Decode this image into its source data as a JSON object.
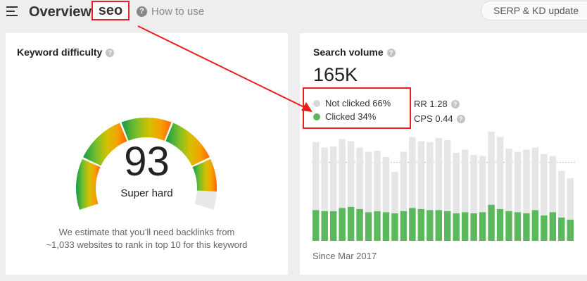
{
  "header": {
    "title": "Overview",
    "keyword": "seo",
    "help_label": "How to use",
    "serp_button_label": "SERP & KD update"
  },
  "keyword_difficulty": {
    "title": "Keyword difficulty",
    "score": "93",
    "rating": "Super hard",
    "score_fraction": 0.93,
    "description_line1": "We estimate that you’ll need backlinks from",
    "description_line2": "~1,033 websites to rank in top 10 for this keyword"
  },
  "search_volume": {
    "title": "Search volume",
    "value": "165K",
    "legend": {
      "not_clicked": "Not clicked 66%",
      "clicked": "Clicked 34%"
    },
    "rr": "RR 1.28",
    "cps": "CPS 0.44",
    "since": "Since Mar 2017"
  },
  "colors": {
    "accent_red": "#e8201e",
    "clicked_green": "#5cb85c",
    "not_clicked_gray": "#e6e6e6"
  },
  "chart_data": {
    "type": "bar",
    "stacked": true,
    "series": [
      {
        "name": "Clicked",
        "values": [
          0.29,
          0.28,
          0.28,
          0.31,
          0.32,
          0.3,
          0.27,
          0.28,
          0.27,
          0.26,
          0.28,
          0.31,
          0.3,
          0.29,
          0.29,
          0.28,
          0.26,
          0.27,
          0.26,
          0.27,
          0.34,
          0.3,
          0.28,
          0.27,
          0.26,
          0.29,
          0.24,
          0.27,
          0.22,
          0.2
        ]
      },
      {
        "name": "Not clicked",
        "values": [
          0.64,
          0.6,
          0.61,
          0.65,
          0.62,
          0.58,
          0.57,
          0.57,
          0.52,
          0.39,
          0.56,
          0.67,
          0.64,
          0.64,
          0.68,
          0.67,
          0.57,
          0.59,
          0.55,
          0.53,
          0.69,
          0.68,
          0.59,
          0.57,
          0.6,
          0.59,
          0.58,
          0.53,
          0.44,
          0.39
        ]
      }
    ],
    "dashed_reference": 0.74,
    "grid": false
  }
}
